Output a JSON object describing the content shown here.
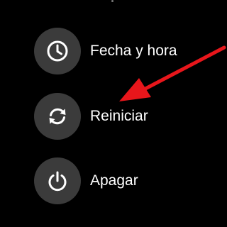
{
  "menu": {
    "items": [
      {
        "label": "Fecha y hora",
        "icon": "clock-icon"
      },
      {
        "label": "Reiniciar",
        "icon": "restart-icon"
      },
      {
        "label": "Apagar",
        "icon": "power-icon"
      }
    ]
  },
  "annotation": {
    "arrow_icon": "red-arrow-annotation",
    "arrow_color": "#e8161b"
  },
  "colors": {
    "background": "#000000",
    "icon_circle": "#3b3b3b",
    "text": "#ffffff"
  }
}
